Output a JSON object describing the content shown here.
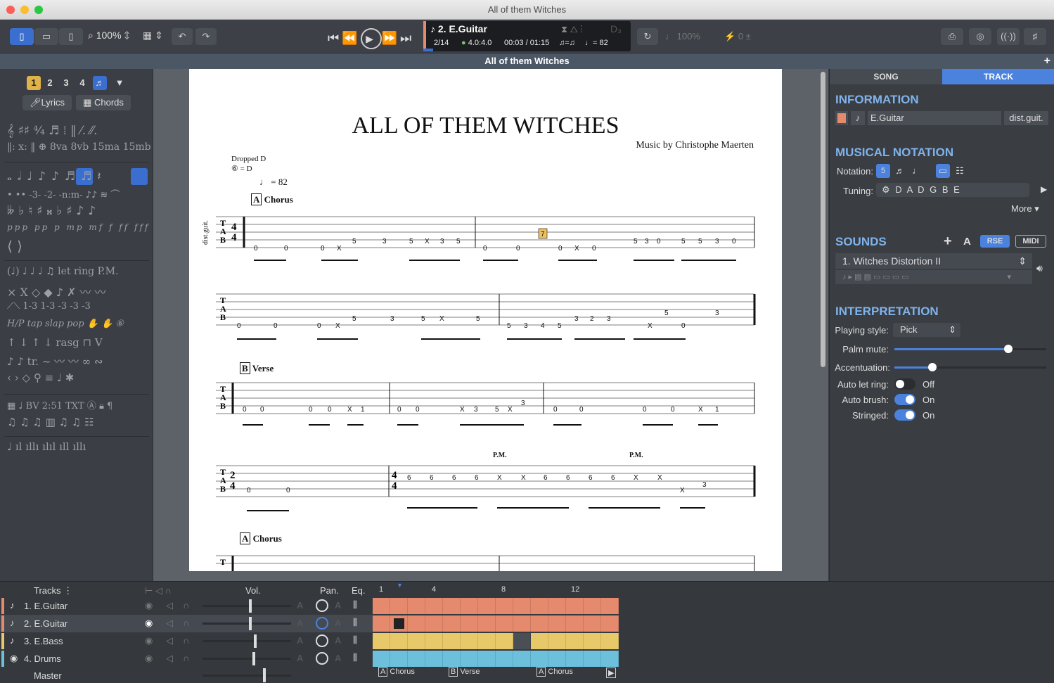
{
  "window": {
    "title": "All of them Witches"
  },
  "toolbar": {
    "zoom": "100%",
    "transport_track": "2. E.Guitar",
    "bar_pos": "2/14",
    "time_sig": "4.0:4.0",
    "time": "00:03 / 01:15",
    "tempo_eq": "♩= 82",
    "triplet": "♫=♫",
    "key": "D₃",
    "speed": "100%",
    "pitch": "0"
  },
  "score": {
    "header": "All of them Witches",
    "title": "ALL OF THEM WITCHES",
    "composer": "Music by Christophe Maerten",
    "tuning_name": "Dropped D",
    "tuning_note": "⑥ = D",
    "tempo": "= 82",
    "track_abbr": "dist.guit.",
    "sections": [
      {
        "letter": "A",
        "name": "Chorus"
      },
      {
        "letter": "B",
        "name": "Verse"
      },
      {
        "letter": "A",
        "name": "Chorus"
      }
    ],
    "pm": "P.M."
  },
  "palette": {
    "voices": [
      "1",
      "2",
      "3",
      "4"
    ],
    "lyrics": "Lyrics",
    "chords": "Chords"
  },
  "right": {
    "tab_song": "SONG",
    "tab_track": "TRACK",
    "info_title": "INFORMATION",
    "track_name": "E.Guitar",
    "track_short": "dist.guit.",
    "notation_title": "MUSICAL NOTATION",
    "notation_label": "Notation:",
    "tuning_label": "Tuning:",
    "tuning_value": "D A D G B E",
    "more": "More",
    "sounds_title": "SOUNDS",
    "rse": "RSE",
    "midi": "MIDI",
    "sound_name": "1. Witches Distortion II",
    "interp_title": "INTERPRETATION",
    "playing_style_label": "Playing style:",
    "playing_style": "Pick",
    "palm_mute_label": "Palm mute:",
    "palm_mute": 0.75,
    "accent_label": "Accentuation:",
    "accent": 0.25,
    "auto_let_ring_label": "Auto let ring:",
    "auto_let_ring": "Off",
    "auto_brush_label": "Auto brush:",
    "auto_brush": "On",
    "stringed_label": "Stringed:",
    "stringed": "On"
  },
  "tracks": {
    "header": "Tracks",
    "vol": "Vol.",
    "pan": "Pan.",
    "eq": "Eq.",
    "bar_numbers": [
      "1",
      "4",
      "8",
      "12"
    ],
    "list": [
      {
        "name": "1. E.Guitar",
        "color": "#e68a6e"
      },
      {
        "name": "2. E.Guitar",
        "color": "#e68a6e"
      },
      {
        "name": "3. E.Bass",
        "color": "#e8c96a"
      },
      {
        "name": "4. Drums",
        "color": "#6cc0dc"
      }
    ],
    "master": "Master",
    "sections": [
      {
        "letter": "A",
        "name": "Chorus"
      },
      {
        "letter": "B",
        "name": "Verse"
      },
      {
        "letter": "A",
        "name": "Chorus"
      }
    ]
  },
  "colors": {
    "accent": "#3a6fd0",
    "section_head": "#7fb3ec"
  }
}
